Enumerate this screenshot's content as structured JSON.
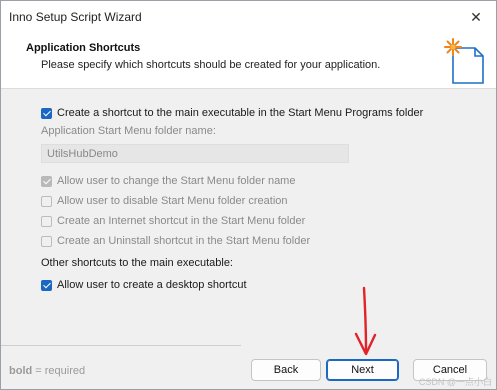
{
  "window": {
    "title": "Inno Setup Script Wizard",
    "close_glyph": "✕"
  },
  "header": {
    "title": "Application Shortcuts",
    "subtitle": "Please specify which shortcuts should be created for your application.",
    "icon": "wizard-page-star-icon",
    "icon_color": "#f0861a"
  },
  "options": {
    "start_menu_shortcut": {
      "label": "Create a shortcut to the main executable in the Start Menu Programs folder",
      "checked": true
    },
    "folder_name_label": "Application Start Menu folder name:",
    "folder_name_value": "UtilsHubDemo",
    "sub_options": [
      {
        "label": "Allow user to change the Start Menu folder name",
        "checked": true,
        "enabled": false
      },
      {
        "label": "Allow user to disable Start Menu folder creation",
        "checked": false,
        "enabled": false
      },
      {
        "label": "Create an Internet shortcut in the Start Menu folder",
        "checked": false,
        "enabled": false
      },
      {
        "label": "Create an Uninstall shortcut in the Start Menu folder",
        "checked": false,
        "enabled": false
      }
    ],
    "other_heading": "Other shortcuts to the main executable:",
    "desktop_shortcut": {
      "label": "Allow user to create a desktop shortcut",
      "checked": true
    }
  },
  "footer": {
    "required_bold": "bold",
    "required_rest": " = required",
    "back_label": "Back",
    "next_label": "Next",
    "cancel_label": "Cancel",
    "watermark": "CSDN @一点小白"
  },
  "annotation": {
    "color": "#e0242a",
    "icon": "red-arrow-annotation"
  },
  "colors": {
    "accent": "#1b68c3"
  }
}
